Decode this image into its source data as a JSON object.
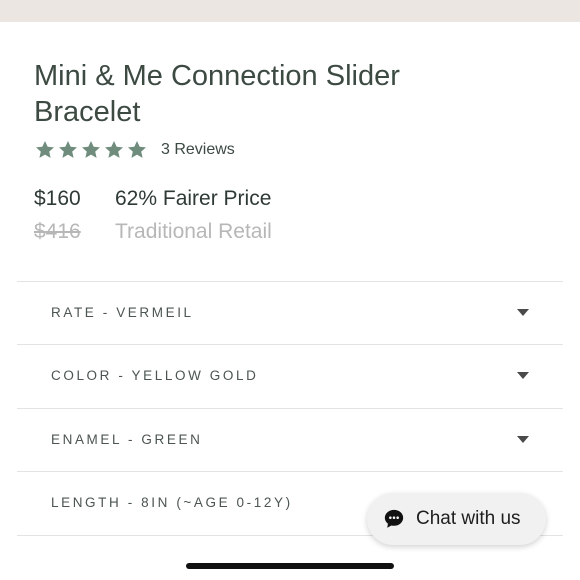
{
  "product": {
    "title": "Mini & Me Connection Slider Bracelet",
    "rating": {
      "stars": 5,
      "reviews_label": "3 Reviews",
      "star_color": "#6f8c7c"
    },
    "price": "$160",
    "original_price": "$416",
    "fairer_price": "62% Fairer Price",
    "retail_label": "Traditional Retail"
  },
  "options": [
    {
      "label": "RATE - VERMEIL"
    },
    {
      "label": "COLOR - YELLOW GOLD"
    },
    {
      "label": "ENAMEL - GREEN"
    },
    {
      "label": "LENGTH - 8IN (~AGE 0-12Y)"
    }
  ],
  "chat": {
    "label": "Chat with us",
    "icon": "chat-bubble-icon"
  }
}
